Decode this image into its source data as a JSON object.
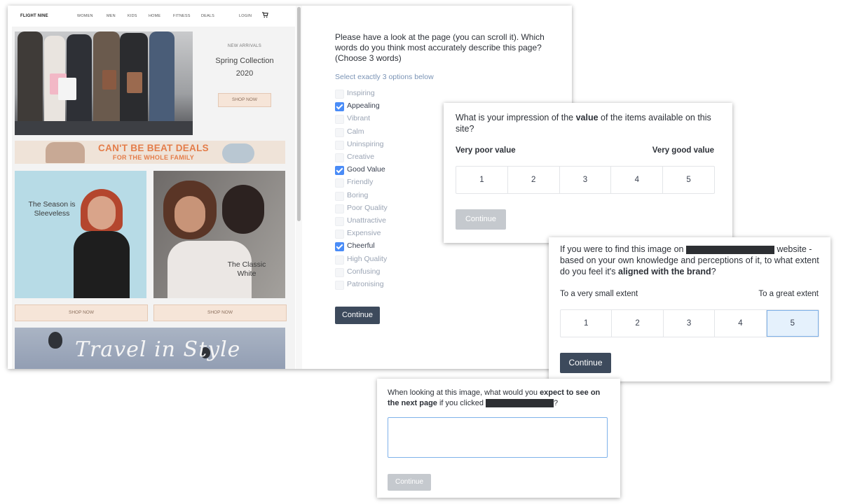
{
  "site": {
    "logo": "FLIGHT NINE",
    "nav": [
      "WOMEN",
      "MEN",
      "KIDS",
      "HOME",
      "FITNESS",
      "DEALS"
    ],
    "login": "LOGIN",
    "cart_icon": "cart-icon",
    "hero": {
      "eyebrow": "NEW ARRIVALS",
      "title_line1": "Spring Collection",
      "title_line2": "2020",
      "button": "SHOP NOW"
    },
    "deals": {
      "title": "CAN'T BE BEAT DEALS",
      "subtitle": "FOR THE WHOLE FAMILY"
    },
    "tiles": [
      {
        "label_line1": "The Season is",
        "label_line2": "Sleeveless",
        "button": "SHOP NOW"
      },
      {
        "label_line1": "The Classic",
        "label_line2": "White",
        "button": "SHOP NOW"
      }
    ],
    "travel": "Travel in Style"
  },
  "q1": {
    "text": "Please have a look at the page (you can scroll it). Which words do you think most accurately describe this page? (Choose 3 words)",
    "helper": "Select exactly 3 options below",
    "options": [
      {
        "label": "Inspiring",
        "checked": false
      },
      {
        "label": "Appealing",
        "checked": true
      },
      {
        "label": "Vibrant",
        "checked": false
      },
      {
        "label": "Calm",
        "checked": false
      },
      {
        "label": "Uninspiring",
        "checked": false
      },
      {
        "label": "Creative",
        "checked": false
      },
      {
        "label": "Good Value",
        "checked": true
      },
      {
        "label": "Friendly",
        "checked": false
      },
      {
        "label": "Boring",
        "checked": false
      },
      {
        "label": "Poor Quality",
        "checked": false
      },
      {
        "label": "Unattractive",
        "checked": false
      },
      {
        "label": "Expensive",
        "checked": false
      },
      {
        "label": "Cheerful",
        "checked": true
      },
      {
        "label": "High Quality",
        "checked": false
      },
      {
        "label": "Confusing",
        "checked": false
      },
      {
        "label": "Patronising",
        "checked": false
      }
    ],
    "continue": "Continue"
  },
  "q2": {
    "text_pre": "What is your impression of the ",
    "text_bold": "value",
    "text_post": " of the items available on this site?",
    "low": "Very poor value",
    "high": "Very good value",
    "scale": [
      "1",
      "2",
      "3",
      "4",
      "5"
    ],
    "selected": null,
    "continue": "Continue"
  },
  "q3": {
    "text_pre": "If you were to find this image on ",
    "text_mid": " website - based on your own knowledge and perceptions of it, to what extent do you feel it's ",
    "text_bold": "aligned with the brand",
    "text_post": "?",
    "low": "To a very small extent",
    "high": "To a great extent",
    "scale": [
      "1",
      "2",
      "3",
      "4",
      "5"
    ],
    "selected": "5",
    "continue": "Continue"
  },
  "q4": {
    "text_pre": "When looking at this image, what would you ",
    "text_bold": "expect to see on the next page",
    "text_mid": " if you clicked ",
    "text_post": "?",
    "answer": "",
    "continue": "Continue"
  },
  "colors": {
    "check_blue": "#4a8cf7",
    "button_dark": "#3d4a5c",
    "button_disabled": "#c5c9ce",
    "deal_orange": "#e47d4a",
    "selected_scale": "#e5f1fc"
  }
}
